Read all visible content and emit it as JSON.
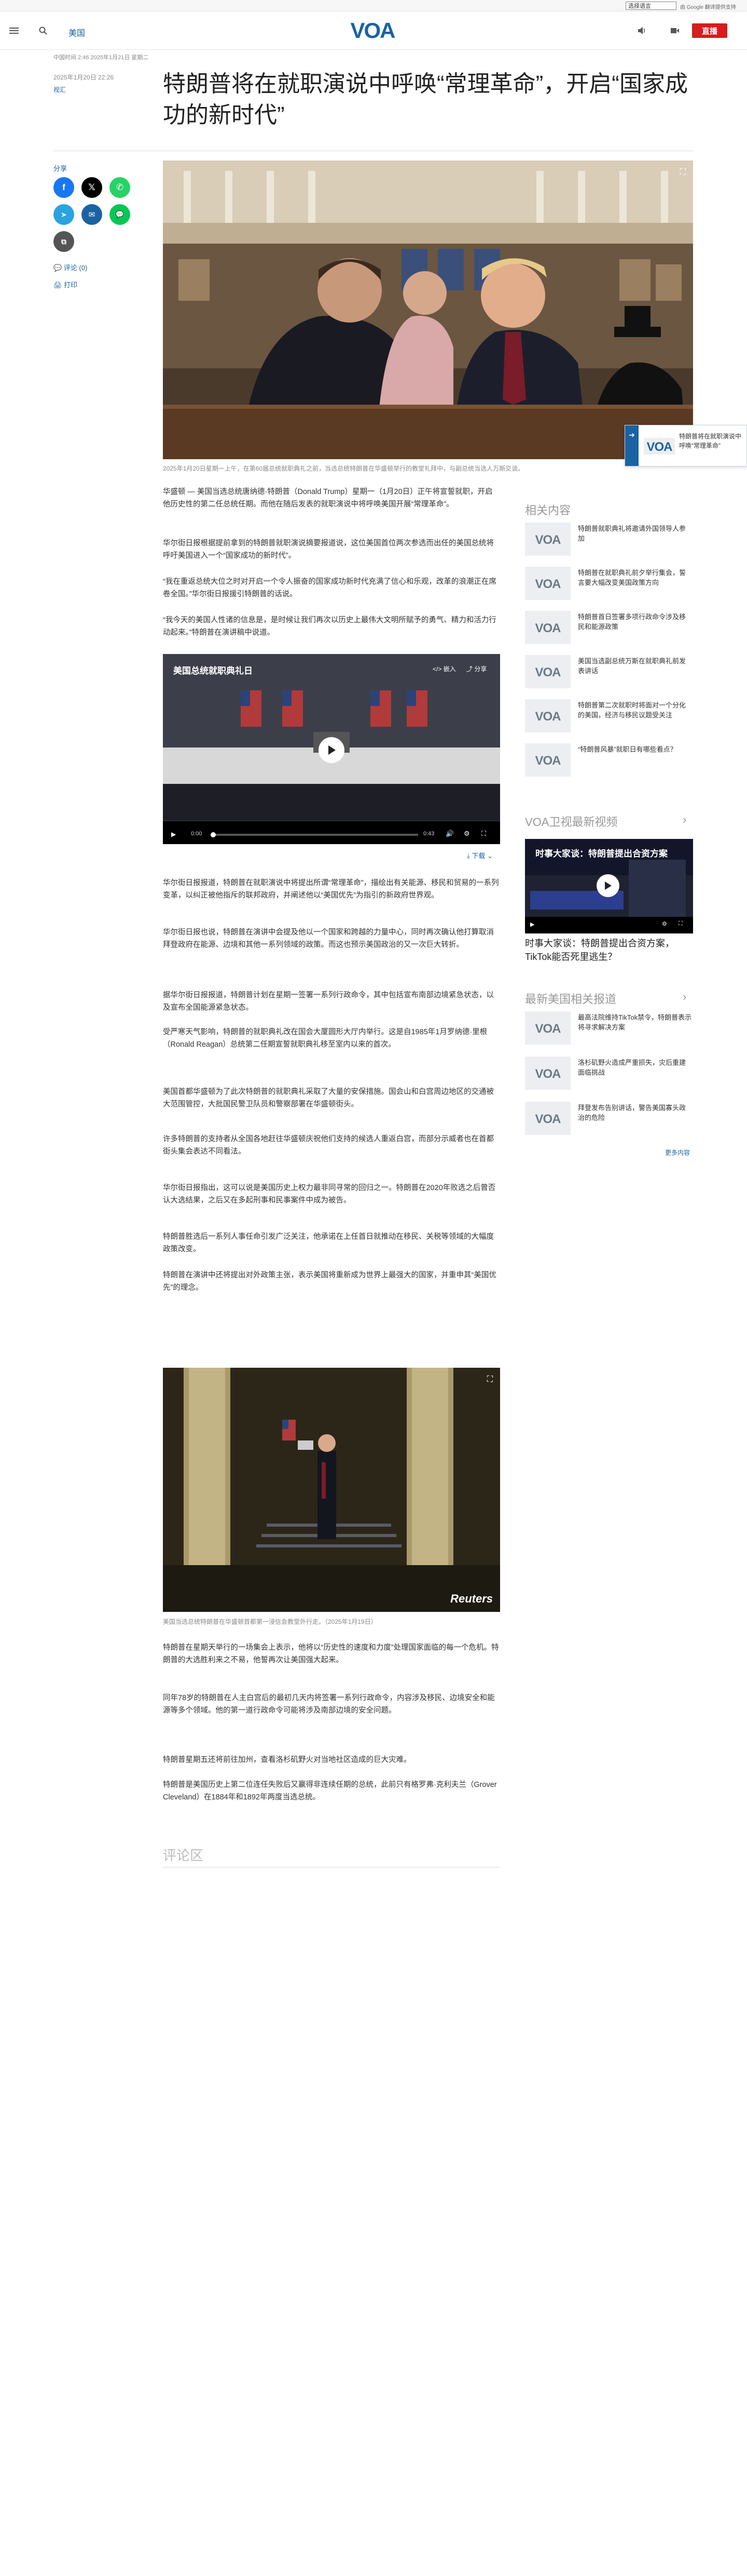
{
  "translate": {
    "select_label": "选择语言",
    "note": "由 Google 翻译提供支持"
  },
  "header": {
    "section": "美国",
    "live": "直播",
    "menu_icon": "menu-icon",
    "search_icon": "search-icon",
    "logo": "VOA"
  },
  "article": {
    "meta_line": "中国时间 2:46 2025年1月21日 星期二",
    "date": "2025年1月20日 22:26",
    "author": "视汇",
    "title": "特朗普将在就职演说中呼唤“常理革命”，开启“国家成功的新时代”",
    "photo_caption": "2025年1月20日星期一上午，在第60届总统就职典礼之前，当选总统特朗普在华盛顿举行的教堂礼拜中，与副总统当选人万斯交谈。",
    "paragraphs": [
      "华盛顿 — 美国当选总统唐纳德·特朗普（Donald Trump）星期一（1月20日）正午将宣誓就职，开启他历史性的第二任总统任期。而他在随后发表的就职演说中将呼唤美国开展“常理革命”。",
      "华尔街日报根据提前拿到的特朗普就职演说摘要报道说，这位美国首位两次参选而出任的美国总统将呼吁美国进入一个“国家成功的新时代”。",
      "“我在重返总统大位之时对开启一个令人振奋的国家成功新时代充满了信心和乐观，改革的浪潮正在席卷全国。”华尔街日报援引特朗普的话说。",
      "“我今天的美国人性诸的信息是，是时候让我们再次以历史上最伟大文明所赋予的勇气、精力和活力行动起来。”特朗普在演讲稿中说道。",
      "华尔街日报报道，特朗普在就职演说中将提出所谓“常理革命”，描绘出有关能源、移民和贸易的一系列变革，以纠正被他指斥的联邦政府，并阐述他以“美国优先”为指引的新政府世界观。",
      "华尔街日报也说，特朗普在演讲中会提及他以一个国家和跨越的力量中心，同时再次确认他打算取消拜登政府在能源、边境和其他一系列领域的政策。而这也预示美国政治的又一次巨大转折。",
      "据华尔街日报报道，特朗普计划在星期一签署一系列行政命令，其中包括宣布南部边境紧急状态，以及宣布全国能源紧急状态。",
      "受严寒天气影响，特朗普的就职典礼改在国会大厦圆形大厅内举行。这是自1985年1月罗纳德·里根（Ronald Reagan）总统第二任期宣誓就职典礼移至室内以来的首次。",
      "美国首都华盛顿为了此次特朗普的就职典礼采取了大量的安保措施。国会山和白宫周边地区的交通被大范围管控，大批国民警卫队员和警察部署在华盛顿街头。",
      "许多特朗普的支持者从全国各地赶往华盛顿庆祝他们支持的候选人重返白宫，而部分示威者也在首都街头集会表达不同看法。",
      "华尔街日报指出，这可以说是美国历史上权力最非同寻常的回归之一。特朗普在2020年败选之后曾否认大选结果，之后又在多起刑事和民事案件中成为被告。",
      "特朗普胜选后一系列人事任命引发广泛关注，他承诺在上任首日就推动在移民、关税等领域的大幅度政策改变。",
      "特朗普在演讲中还将提出对外政策主张，表示美国将重新成为世界上最强大的国家，并重申其“美国优先”的理念。"
    ],
    "paragraphs2": [
      "特朗普在星期天举行的一场集会上表示，他将以“历史性的速度和力度”处理国家面临的每一个危机。特朗普的大选胜利来之不易，他誓再次让美国强大起来。",
      "同年78岁的特朗普在人主白宫后的最初几天内将签署一系列行政命令，内容涉及移民、边境安全和能源等多个领域。他的第一道行政命令可能将涉及南部边境的安全问题。",
      "特朗普星期五还将前往加州，查看洛杉矶野火对当地社区造成的巨大灾难。",
      "特朗普是美国历史上第二位连任失败后又赢得非连续任期的总统，此前只有格罗弗·克利夫兰（Grover Cleveland）在1884年和1892年两度当选总统。"
    ],
    "photo2_caption": "美国当选总统特朗普在华盛顿首都第一浸信会教堂外行走。（2025年1月19日）",
    "photo2_watermark": "Reuters",
    "download_label": "下载",
    "comments_heading": "评论区"
  },
  "share": {
    "label": "分享",
    "comment_label": "评论 (0)",
    "print_label": "打印"
  },
  "video": {
    "title": "美国总统就职典礼日",
    "time_current": "0:00",
    "time_total": "0:43",
    "embed_label": "嵌入",
    "share_label": "分享"
  },
  "sidebar": {
    "related_heading": "相关内容",
    "related": [
      "特朗普就职典礼将邀请外国领导人参加",
      "特朗普在就职典礼前夕举行集会，誓言要大幅改变美国政策方向",
      "特朗普首日签署多项行政命令涉及移民和能源政策",
      "美国当选副总统万斯在就职典礼前发表讲话",
      "特朗普第二次就职时将面对一个分化的美国，经济与移民议题受关注",
      "“特朗普风暴”就职日有哪些看点？"
    ],
    "video_heading": "VOA卫视最新视频",
    "video_title": "时事大家谈：特朗普提出合资方案，TikTok能否死里逃生？",
    "video_overlay": "时事大家谈：特朗普提出合资方案",
    "latest_heading": "最新美国相关报道",
    "latest": [
      "最高法院维持TikTok禁令，特朗普表示将寻求解决方案",
      "洛杉矶野火造成严重损失，灾后重建面临挑战",
      "拜登发布告别讲话，警告美国寡头政治的危险"
    ],
    "more_label": "更多内容"
  },
  "mini_player": {
    "text": "特朗普将在就职演说中呼唤“常理革命”"
  },
  "colors": {
    "brand_blue": "#1b62a3",
    "live_red": "#d61c1f",
    "facebook": "#1877f2",
    "x": "#000000",
    "whatsapp": "#25d366",
    "telegram": "#2aa3df",
    "email": "#1b62a3",
    "line": "#06c755"
  }
}
